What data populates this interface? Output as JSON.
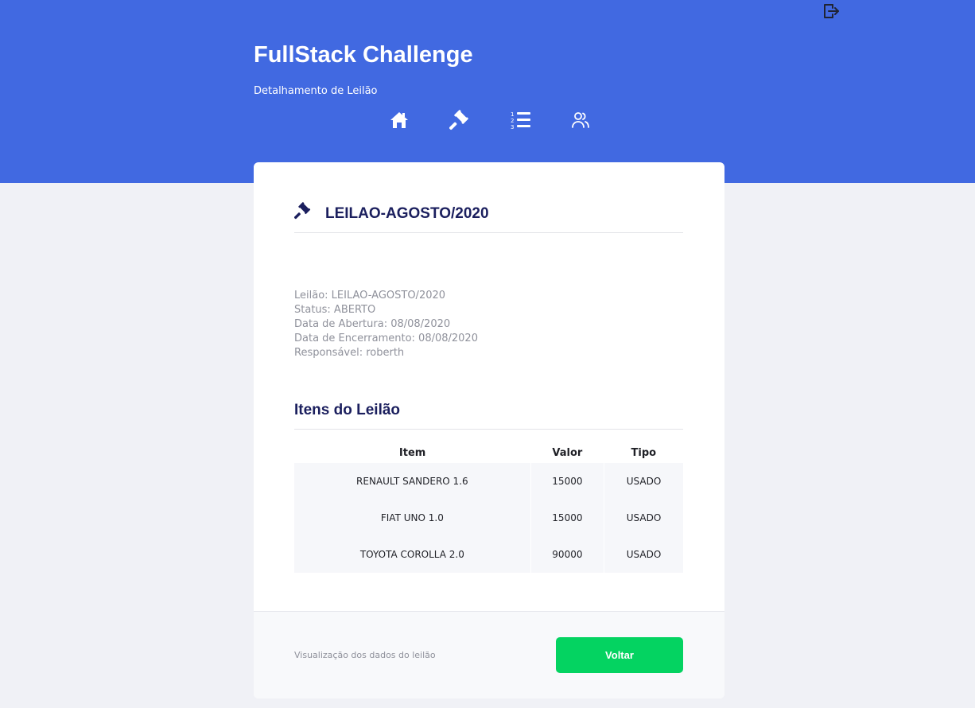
{
  "header": {
    "app_title": "FullStack Challenge",
    "page_subtitle": "Detalhamento de Leilão",
    "nav": [
      {
        "icon": "home-icon"
      },
      {
        "icon": "gavel-icon"
      },
      {
        "icon": "numbered-list-icon"
      },
      {
        "icon": "users-icon"
      }
    ],
    "logout_icon": "logout-icon"
  },
  "card": {
    "title": "LEILAO-AGOSTO/2020",
    "details": {
      "leilao": "Leilão: LEILAO-AGOSTO/2020",
      "status": "Status: ABERTO",
      "abertura": "Data de Abertura: 08/08/2020",
      "encerramento": "Data de Encerramento: 08/08/2020",
      "responsavel": "Responsável: roberth"
    },
    "items_title": "Itens do Leilão",
    "table": {
      "columns": [
        "Item",
        "Valor",
        "Tipo"
      ],
      "rows": [
        [
          "RENAULT SANDERO 1.6",
          "15000",
          "USADO"
        ],
        [
          "FIAT UNO 1.0",
          "15000",
          "USADO"
        ],
        [
          "TOYOTA COROLLA 2.0",
          "90000",
          "USADO"
        ]
      ]
    },
    "footer_text": "Visualização dos dados do leilão",
    "back_label": "Voltar"
  },
  "colors": {
    "header_bg": "#4169e1",
    "title_color": "#1b1f5e",
    "button_green": "#04d361",
    "page_bg": "#f0f1f6"
  }
}
